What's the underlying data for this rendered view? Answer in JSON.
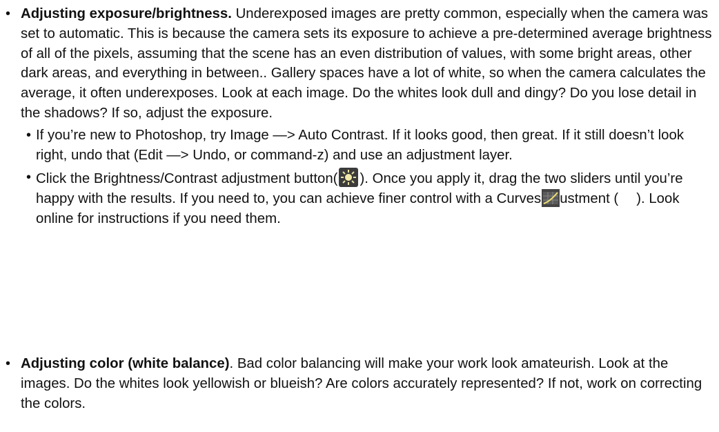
{
  "items": [
    {
      "title": "Adjusting exposure/brightness.",
      "body": " Underexposed images are pretty common, especially when the camera was set to automatic. This is because the camera sets its exposure to achieve a pre-determined average brightness of all of the pixels, assuming that the scene has an even distribution of values, with some bright areas, other dark areas, and everything in between.. Gallery spaces have a lot of white, so when the camera calculates the average, it often underexposes. Look at each image. Do the whites look dull and dingy? Do you lose detail in the shadows? If so, adjust the exposure.",
      "sub_items": [
        {
          "text": "If you’re new to Photoshop, try Image —> Auto Contrast. If it looks good, then great. If it still doesn’t look right, undo that (Edit —> Undo, or command-z) and use an adjustment layer."
        },
        {
          "text_a": "Click the Brightness/Contrast adjustment button(",
          "text_b": "). Once you apply it, drag the two sliders until you’re happy with the results. If you need to, you can achieve finer control with a Curves a",
          "text_c": "ustment (",
          "text_d": "). Look online for instructions if you need them.",
          "icon_brightness": "brightness-contrast-icon",
          "icon_curves": "curves-icon"
        }
      ]
    },
    {
      "title": "Adjusting color (white balance)",
      "body": ". Bad color balancing will make your work look amateurish. Look at the images. Do the whites look yellowish or blueish? Are colors accurately represented? If not, work on correcting the colors."
    }
  ],
  "bullet_char": "•"
}
